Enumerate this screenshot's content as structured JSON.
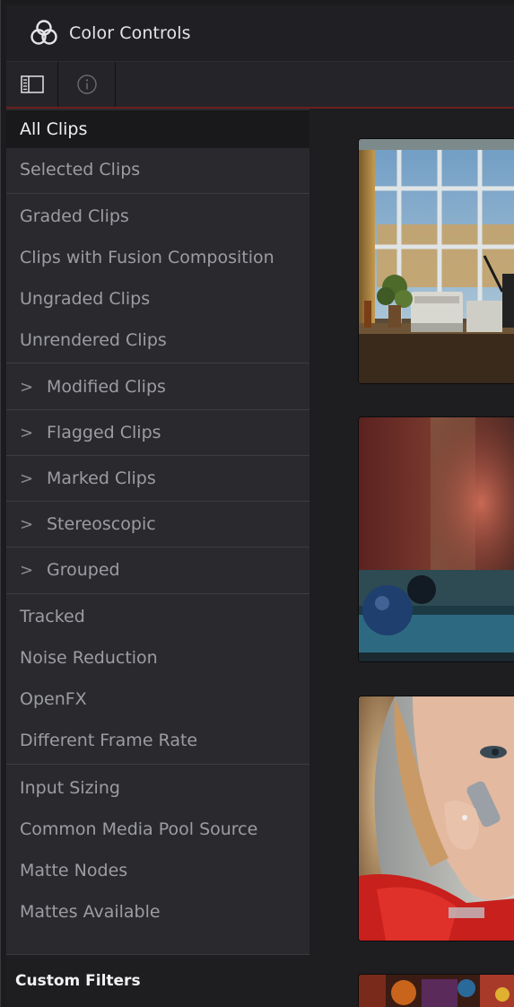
{
  "app": {
    "title": "Color Controls",
    "logo_icon": "resolve-logo-icon"
  },
  "toolbar": {
    "buttons": [
      {
        "icon": "sidebar-toggle-icon"
      },
      {
        "icon": "info-icon"
      }
    ],
    "accent_color": "#6e1e1e"
  },
  "sidebar": {
    "items": [
      {
        "label": "All Clips",
        "selected": true
      },
      {
        "label": "Selected Clips"
      },
      {
        "label": "Graded Clips"
      },
      {
        "label": "Clips with Fusion Composition"
      },
      {
        "label": "Ungraded Clips"
      },
      {
        "label": "Unrendered Clips"
      },
      {
        "label": "Modified Clips",
        "expandable": true
      },
      {
        "label": "Flagged Clips",
        "expandable": true
      },
      {
        "label": "Marked Clips",
        "expandable": true
      },
      {
        "label": "Stereoscopic",
        "expandable": true
      },
      {
        "label": "Grouped",
        "expandable": true
      },
      {
        "label": "Tracked"
      },
      {
        "label": "Noise Reduction"
      },
      {
        "label": "OpenFX"
      },
      {
        "label": "Different Frame Rate"
      },
      {
        "label": "Input Sizing"
      },
      {
        "label": "Common Media Pool Source"
      },
      {
        "label": "Matte Nodes"
      },
      {
        "label": "Mattes Available"
      }
    ],
    "custom_filters_label": "Custom Filters"
  },
  "thumbnails": [
    {
      "scene": "office-window-printer"
    },
    {
      "scene": "pool-table-blur"
    },
    {
      "scene": "woman-on-phone"
    },
    {
      "scene": "colorful-partial"
    }
  ]
}
